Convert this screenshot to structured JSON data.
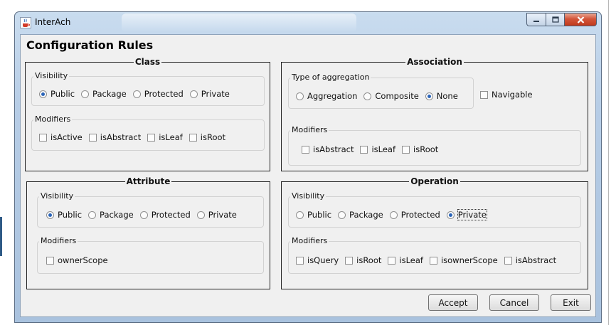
{
  "window": {
    "title": "InterAch"
  },
  "heading": "Configuration Rules",
  "panels": {
    "class": {
      "title": "Class",
      "visibility": {
        "label": "Visibility",
        "options": [
          "Public",
          "Package",
          "Protected",
          "Private"
        ],
        "selected": "Public"
      },
      "modifiers": {
        "label": "Modifiers",
        "items": [
          "isActive",
          "isAbstract",
          "isLeaf",
          "isRoot"
        ]
      }
    },
    "association": {
      "title": "Association",
      "aggregation": {
        "label": "Type of aggregation",
        "options": [
          "Aggregation",
          "Composite",
          "None"
        ],
        "selected": "None"
      },
      "navigable": "Navigable",
      "modifiers": {
        "label": "Modifiers",
        "items": [
          "isAbstract",
          "isLeaf",
          "isRoot"
        ]
      }
    },
    "attribute": {
      "title": "Attribute",
      "visibility": {
        "label": "Visibility",
        "options": [
          "Public",
          "Package",
          "Protected",
          "Private"
        ],
        "selected": "Public"
      },
      "modifiers": {
        "label": "Modifiers",
        "items": [
          "ownerScope"
        ]
      }
    },
    "operation": {
      "title": "Operation",
      "visibility": {
        "label": "Visibility",
        "options": [
          "Public",
          "Package",
          "Protected",
          "Private"
        ],
        "selected": "Private"
      },
      "modifiers": {
        "label": "Modifiers",
        "items": [
          "isQuery",
          "isRoot",
          "isLeaf",
          "isownerScope",
          "isAbstract"
        ]
      }
    }
  },
  "buttons": {
    "accept": "Accept",
    "cancel": "Cancel",
    "exit": "Exit"
  },
  "icons": {
    "app": "java-cup-icon",
    "minimize": "minimize-icon",
    "maximize": "maximize-icon",
    "close": "close-icon"
  },
  "colors": {
    "selected_radio": "#2a64b8",
    "close_button": "#c9452a",
    "titlebar": "#b7cde6"
  }
}
